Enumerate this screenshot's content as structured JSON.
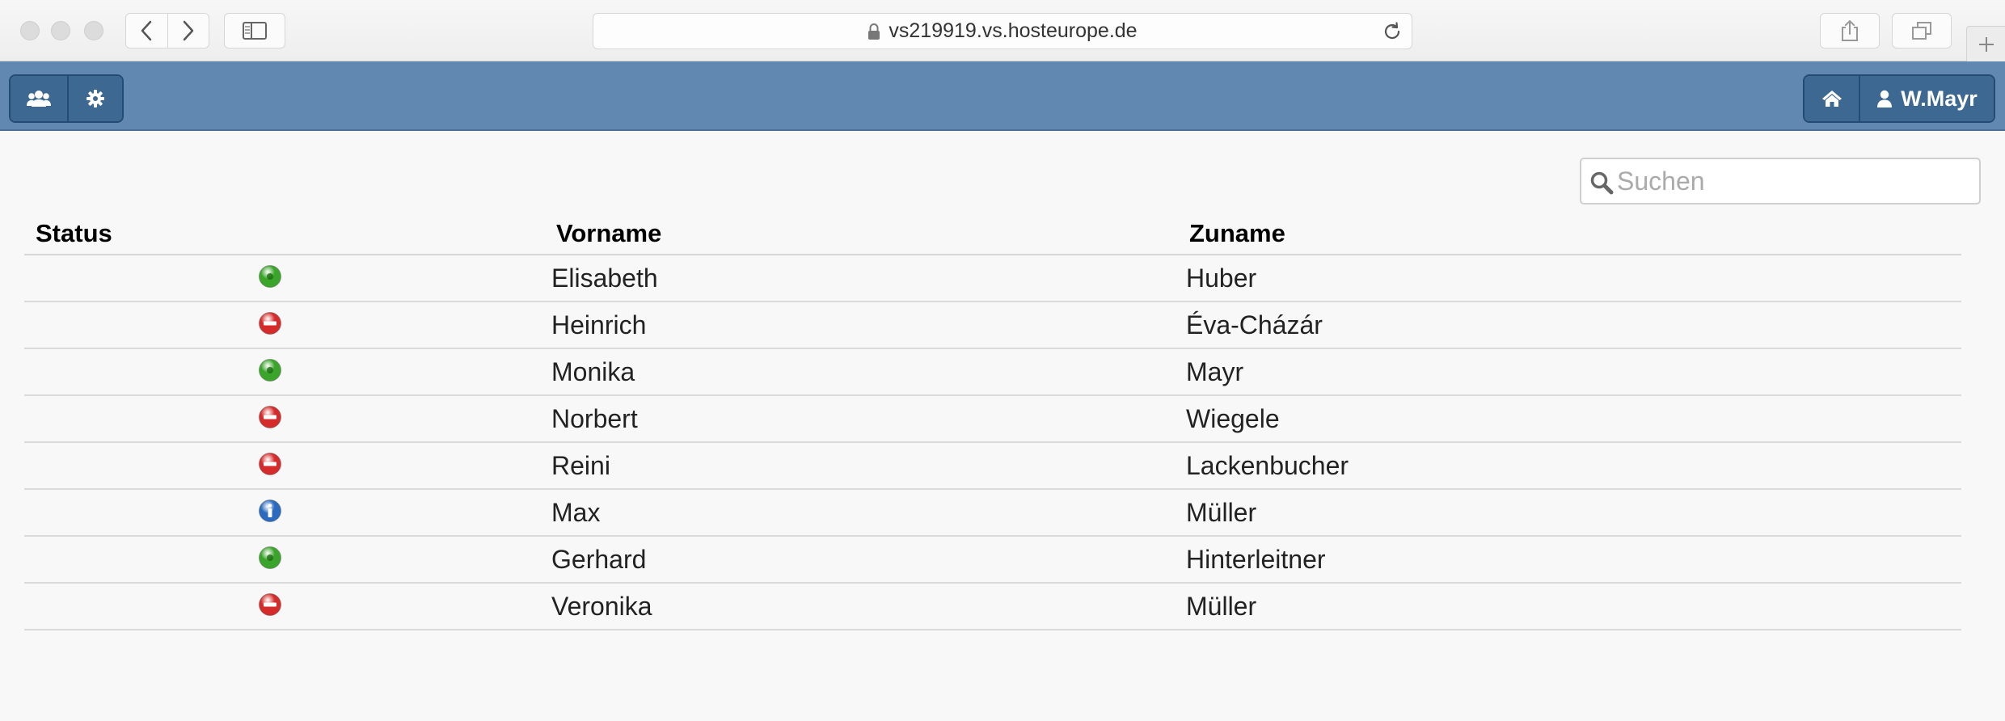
{
  "browser": {
    "url": "vs219919.vs.hosteurope.de"
  },
  "header": {
    "user_name": "W.Mayr"
  },
  "search": {
    "placeholder": "Suchen"
  },
  "table": {
    "columns": [
      "Status",
      "Vorname",
      "Zuname"
    ],
    "rows": [
      {
        "status": "online",
        "vorname": "Elisabeth",
        "zuname": "Huber"
      },
      {
        "status": "blocked",
        "vorname": "Heinrich",
        "zuname": "Éva-Cházár"
      },
      {
        "status": "online",
        "vorname": "Monika",
        "zuname": "Mayr"
      },
      {
        "status": "blocked",
        "vorname": "Norbert",
        "zuname": "Wiegele"
      },
      {
        "status": "blocked",
        "vorname": "Reini",
        "zuname": "Lackenbucher"
      },
      {
        "status": "info",
        "vorname": "Max",
        "zuname": "Müller"
      },
      {
        "status": "online",
        "vorname": "Gerhard",
        "zuname": "Hinterleitner"
      },
      {
        "status": "blocked",
        "vorname": "Veronika",
        "zuname": "Müller"
      }
    ]
  },
  "status_colors": {
    "online": "#3aa52a",
    "blocked": "#d62b2b",
    "info": "#2a6bbf"
  },
  "colors": {
    "appbar": "#6088b0",
    "button": "#3d6891",
    "button_border": "#254b74"
  }
}
